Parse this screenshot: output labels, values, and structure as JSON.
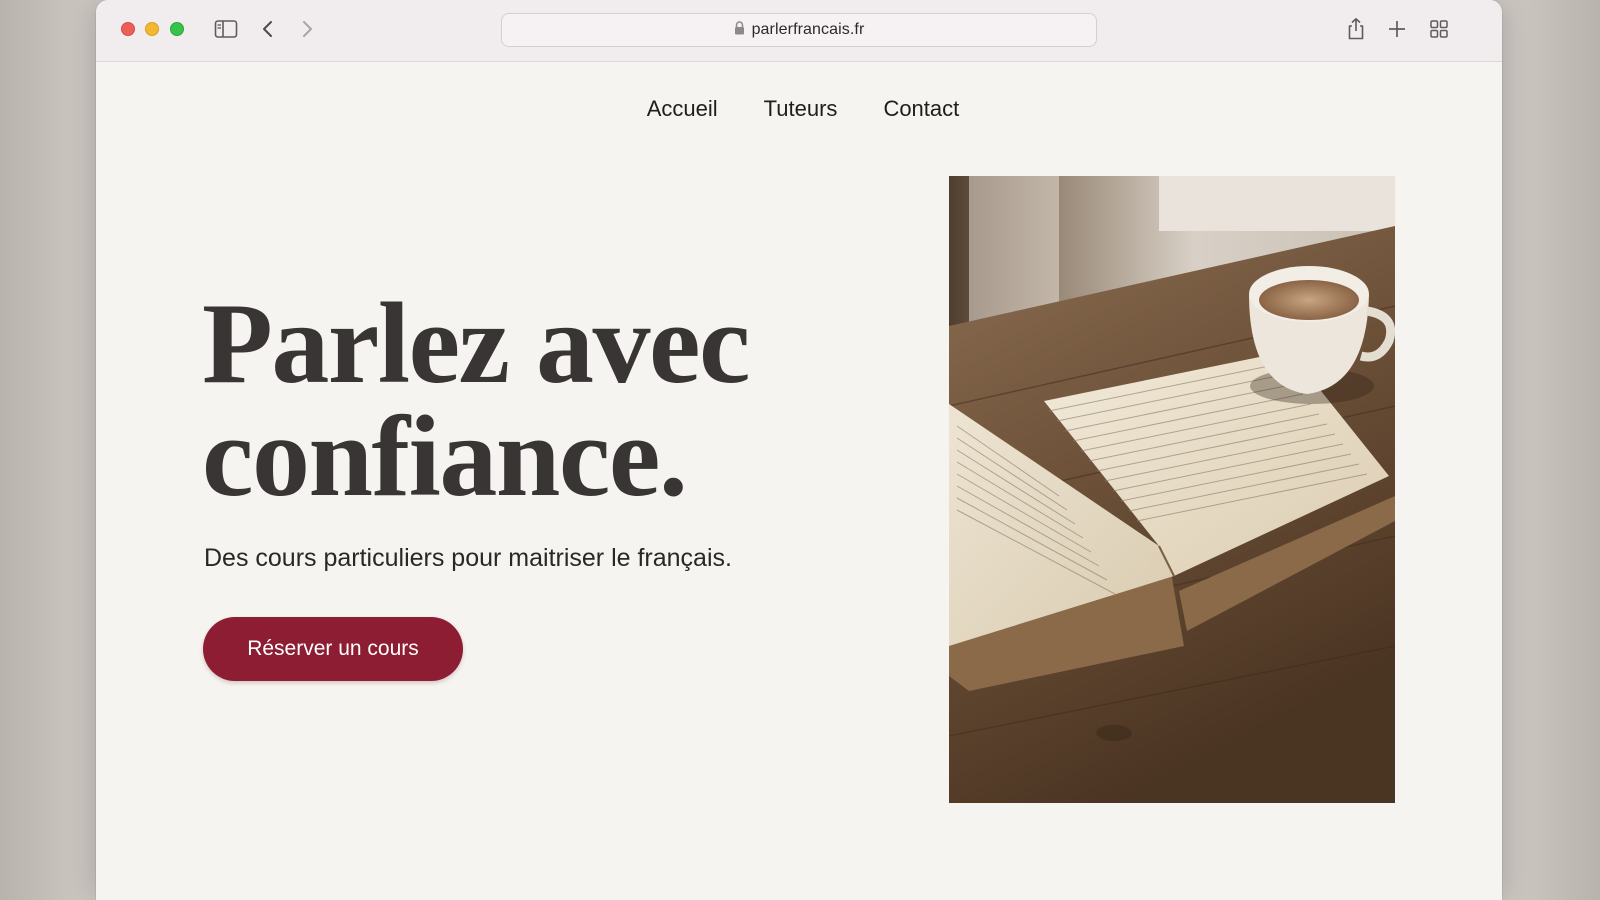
{
  "browser": {
    "url": "parlerfrancais.fr",
    "icons": [
      "sidebar-icon",
      "back-arrow-icon",
      "forward-arrow-icon",
      "lock-icon",
      "share-icon",
      "new-tab-icon",
      "tab-overview-icon"
    ]
  },
  "nav": {
    "items": [
      {
        "label": "Accueil"
      },
      {
        "label": "Tuteurs"
      },
      {
        "label": "Contact"
      }
    ]
  },
  "hero": {
    "headline_line1": "Parlez avec",
    "headline_line2": "confiance.",
    "subtitle": "Des cours particuliers pour maitriser le français.",
    "cta_label": "Réserver un cours",
    "cta_color": "#8c1d32"
  },
  "image": {
    "subject": "open book and coffee cup on wooden table"
  },
  "colors": {
    "page_background": "#f6f4f0",
    "headline": "#3a3535",
    "accent": "#8c1d32"
  }
}
